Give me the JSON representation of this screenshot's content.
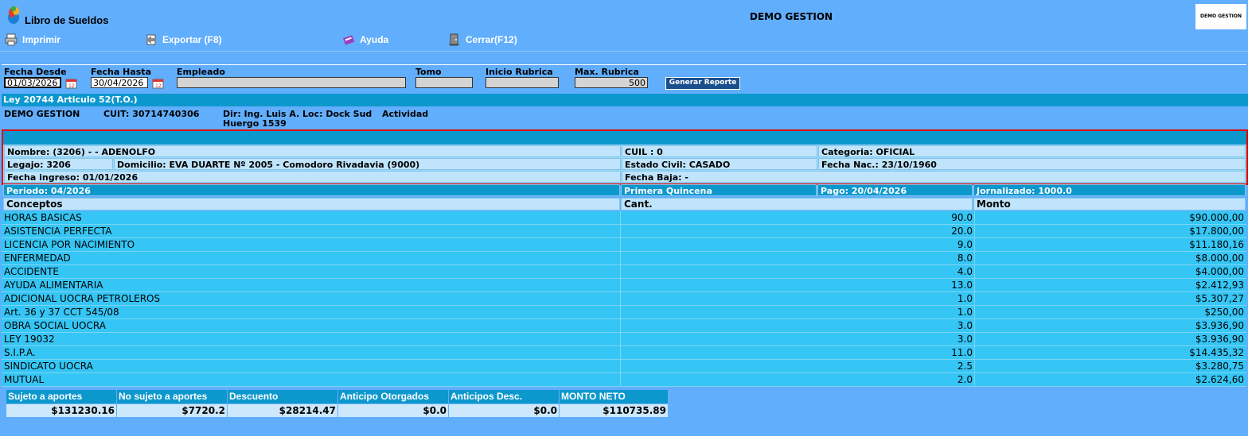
{
  "app": {
    "title": "Libro de Sueldos",
    "company": "DEMO GESTION",
    "logo_text": "DEMO GESTION"
  },
  "toolbar": {
    "print_label": "Imprimir",
    "export_label": "Exportar (F8)",
    "help_label": "Ayuda",
    "close_label": "Cerrar(F12)"
  },
  "filters": {
    "fecha_desde_label": "Fecha Desde",
    "fecha_desde": "01/03/2026",
    "fecha_hasta_label": "Fecha Hasta",
    "fecha_hasta": "30/04/2026",
    "empleado_label": "Empleado",
    "empleado": "",
    "tomo_label": "Tomo",
    "tomo": "",
    "inicio_label": "Inicio Rubrica",
    "inicio": "",
    "max_label": "Max. Rubrica",
    "max": "500",
    "generate_label": "Generar Reporte"
  },
  "report": {
    "law": "Ley 20744 Articulo 52(T.O.)",
    "company_name": "DEMO GESTION",
    "cuit": "CUIT: 30714740306",
    "dir": "Dir: Ing. Luis A.",
    "dir2": "Huergo 1539",
    "loc": "Loc: Dock Sud",
    "actividad": "Actividad"
  },
  "employee": {
    "nombre": "Nombre: (3206) - - ADENOLFO",
    "cuil": "CUIL : 0",
    "categoria": "Categoria: OFICIAL",
    "legajo": "Legajo: 3206",
    "domicilio": "Domicilio: EVA DUARTE Nº 2005 - Comodoro Rivadavia (9000)",
    "estado_civil": "Estado Civil: CASADO",
    "fecha_nac": "Fecha Nac.: 23/10/1960",
    "fecha_ingreso": "Fecha ingreso: 01/01/2026",
    "fecha_baja": "Fecha Baja: -"
  },
  "period": {
    "periodo": "Periodo:  04/2026",
    "quincena": "Primera Quincena",
    "pago": "Pago: 20/04/2026",
    "jornalizado": "Jornalizado: 1000.0"
  },
  "columns": {
    "conceptos": "Conceptos",
    "cant": "Cant.",
    "monto": "Monto"
  },
  "concepts": [
    {
      "name": "HORAS BASICAS",
      "cant": "90.0",
      "monto": "$90.000,00"
    },
    {
      "name": "ASISTENCIA PERFECTA",
      "cant": "20.0",
      "monto": "$17.800,00"
    },
    {
      "name": "LICENCIA POR NACIMIENTO",
      "cant": "9.0",
      "monto": "$11.180,16"
    },
    {
      "name": "ENFERMEDAD",
      "cant": "8.0",
      "monto": "$8.000,00"
    },
    {
      "name": "ACCIDENTE",
      "cant": "4.0",
      "monto": "$4.000,00"
    },
    {
      "name": "AYUDA ALIMENTARIA",
      "cant": "13.0",
      "monto": "$2.412,93"
    },
    {
      "name": "ADICIONAL UOCRA PETROLEROS",
      "cant": "1.0",
      "monto": "$5.307,27"
    },
    {
      "name": "Art. 36 y 37 CCT 545/08",
      "cant": "1.0",
      "monto": "$250,00"
    },
    {
      "name": "OBRA SOCIAL UOCRA",
      "cant": "3.0",
      "monto": "$3.936,90"
    },
    {
      "name": "LEY 19032",
      "cant": "3.0",
      "monto": "$3.936,90"
    },
    {
      "name": "S.I.P.A.",
      "cant": "11.0",
      "monto": "$14.435,32"
    },
    {
      "name": "SINDICATO UOCRA",
      "cant": "2.5",
      "monto": "$3.280,75"
    },
    {
      "name": "MUTUAL",
      "cant": "2.0",
      "monto": "$2.624,60"
    }
  ],
  "totals": [
    {
      "label": "Sujeto a aportes",
      "value": "$131230.16"
    },
    {
      "label": "No sujeto a aportes",
      "value": "$7720.2"
    },
    {
      "label": "Descuento",
      "value": "$28214.47"
    },
    {
      "label": "Anticipo Otorgados",
      "value": "$0.0"
    },
    {
      "label": "Anticipos Desc.",
      "value": "$0.0"
    },
    {
      "label": "MONTO NETO",
      "value": "$110735.89"
    }
  ],
  "colors": {
    "background": "#61aefd",
    "header_bar": "#0d98cd",
    "row": "#35c6f5",
    "highlight_border": "#e00000"
  }
}
